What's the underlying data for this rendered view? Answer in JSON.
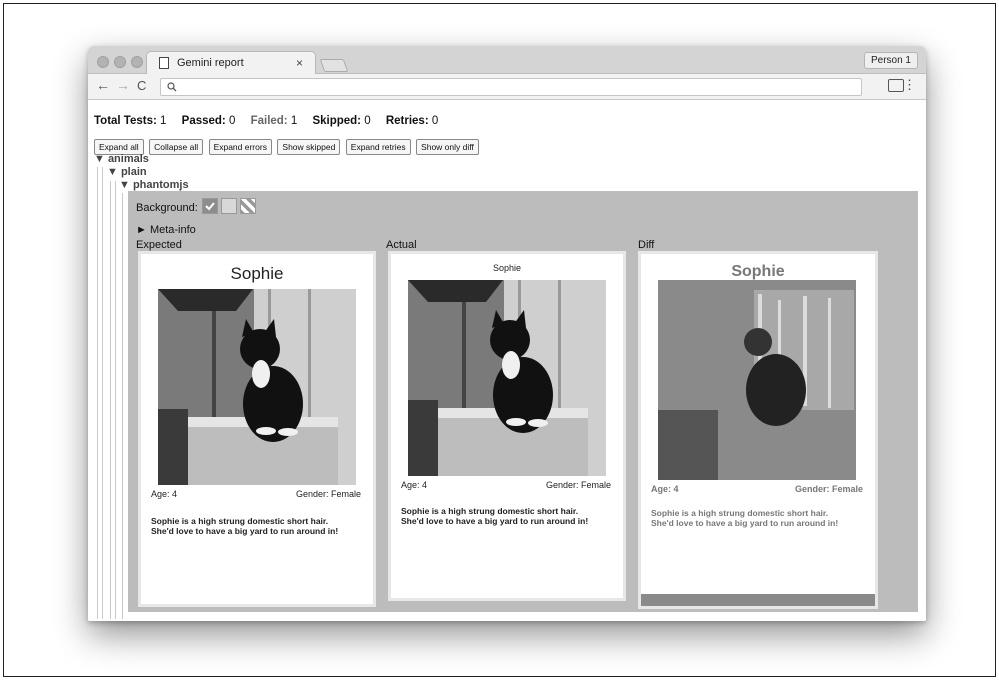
{
  "window": {
    "tab_title": "Gemini report",
    "tab_close": "×",
    "person": "Person 1",
    "nav_back": "←",
    "nav_forward": "→",
    "nav_reload": "C",
    "search_icon": "search-icon",
    "menu_icon": "⋮"
  },
  "summary": {
    "total_label": "Total Tests:",
    "total_value": "1",
    "passed_label": "Passed:",
    "passed_value": "0",
    "failed_label": "Failed:",
    "failed_value": "1",
    "skipped_label": "Skipped:",
    "skipped_value": "0",
    "retries_label": "Retries:",
    "retries_value": "0"
  },
  "buttons": {
    "expand_all": "Expand all",
    "collapse_all": "Collapse all",
    "expand_errors": "Expand errors",
    "show_skipped": "Show skipped",
    "expand_retries": "Expand retries",
    "show_only_diff": "Show only diff"
  },
  "tree": {
    "level1": "▼ animals",
    "level2": "▼ plain",
    "level3": "▼ phantomjs"
  },
  "panel": {
    "background_label": "Background:",
    "meta_info": "► Meta-info",
    "expected_label": "Expected",
    "actual_label": "Actual",
    "diff_label": "Diff"
  },
  "cards": {
    "name": "Sophie",
    "age": "Age: 4",
    "gender": "Gender: Female",
    "desc_line1": "Sophie is a high strung domestic short hair.",
    "desc_line2": "She'd love to have a big yard to run around in!"
  },
  "colors": {
    "panel_bg": "#bcbcbc",
    "diff_highlight": "#8a8a8a"
  }
}
